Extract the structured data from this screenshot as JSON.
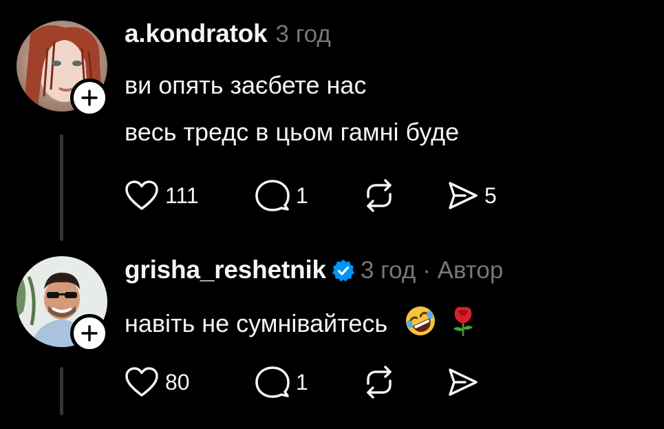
{
  "comments": [
    {
      "username": "a.kondratok",
      "verified": false,
      "time": "3 год",
      "author_tag": "",
      "lines": [
        "ви опять заєбете нас",
        "весь тредс в цьом гамні буде"
      ],
      "likes": "111",
      "replies": "1",
      "shares": "5"
    },
    {
      "username": "grisha_reshetnik",
      "verified": true,
      "time": "3 год",
      "author_tag": "· Автор",
      "lines": [
        "навіть не сумнівайтесь"
      ],
      "emojis": [
        "rolling-on-floor-laughing-emoji",
        "rose-emoji"
      ],
      "likes": "80",
      "replies": "1",
      "shares": ""
    }
  ],
  "colors": {
    "background": "#000000",
    "text": "#f3f5f7",
    "muted": "#777777",
    "verified": "#0095f6",
    "thread_line": "#333638"
  },
  "icons": [
    "plus-icon",
    "heart-icon",
    "comment-icon",
    "repost-icon",
    "share-icon",
    "verified-badge-icon"
  ]
}
